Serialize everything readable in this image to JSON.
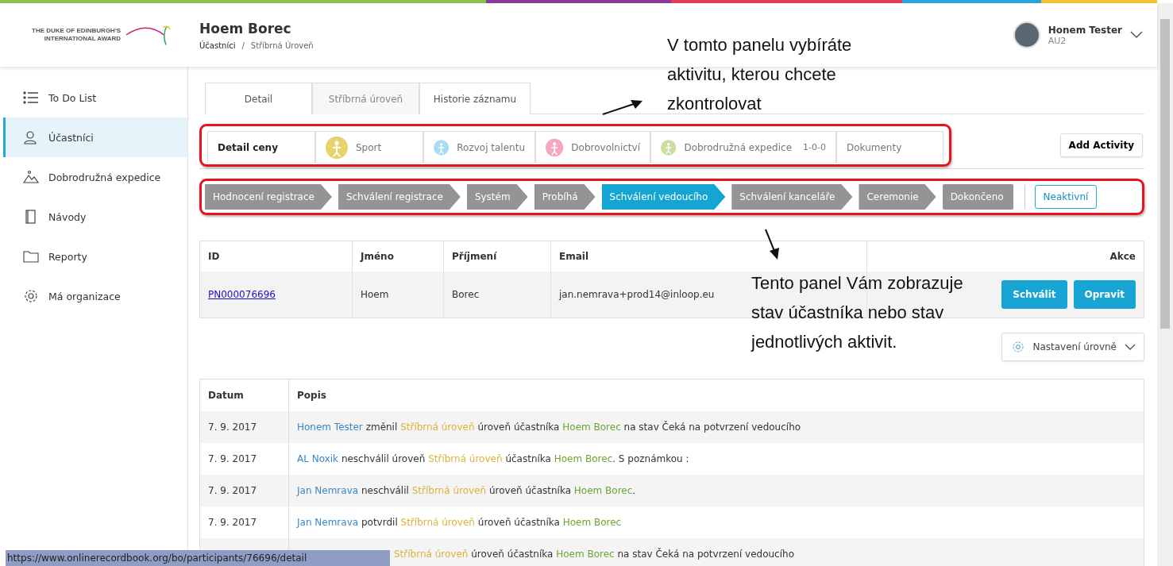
{
  "logo": {
    "lines": [
      "THE DUKE OF EDINBURGH'S",
      "INTERNATIONAL AWARD"
    ]
  },
  "header": {
    "name": "Hoem Borec",
    "breadcrumb": [
      "Účastníci",
      "Stříbrná Úroveň"
    ],
    "separator": "/",
    "user": {
      "name": "Honem Tester",
      "role": "AU2"
    }
  },
  "sidebar": {
    "items": [
      {
        "label": "To Do List",
        "selected": false,
        "kind": "list"
      },
      {
        "label": "Účastníci",
        "selected": true,
        "kind": "people"
      },
      {
        "label": "Dobrodružná expedice",
        "selected": false,
        "kind": "mountain"
      },
      {
        "label": "Návody",
        "selected": false,
        "kind": "book"
      },
      {
        "label": "Reporty",
        "selected": false,
        "kind": "folder"
      },
      {
        "label": "Má organizace",
        "selected": false,
        "kind": "gear"
      }
    ]
  },
  "tabs": [
    {
      "label": "Detail",
      "selected": false
    },
    {
      "label": "Stříbrná úroveň",
      "selected": true
    },
    {
      "label": "Historie záznamu",
      "selected": false
    }
  ],
  "activities": [
    {
      "label": "Detail ceny",
      "selected": true
    },
    {
      "label": "Sport",
      "selected": false,
      "color": "#e6d36b"
    },
    {
      "label": "Rozvoj talentu",
      "selected": false,
      "color": "#a9dcf2"
    },
    {
      "label": "Dobrovolnictví",
      "selected": false,
      "color": "#f4a7be"
    },
    {
      "label": "Dobrodružná expedice",
      "selected": false,
      "color": "#c9dea0",
      "count": "1-0-0"
    },
    {
      "label": "Dokumenty",
      "selected": false
    }
  ],
  "add_activity": "Add Activity",
  "steps": [
    {
      "label": "Hodnocení registrace",
      "selected": false
    },
    {
      "label": "Schválení registrace",
      "selected": false
    },
    {
      "label": "Systém",
      "selected": false
    },
    {
      "label": "Probíhá",
      "selected": false
    },
    {
      "label": "Schválení vedoucího",
      "selected": true
    },
    {
      "label": "Schválení kanceláře",
      "selected": false
    },
    {
      "label": "Ceremonie",
      "selected": false
    },
    {
      "label": "Dokončeno",
      "selected": false
    }
  ],
  "status_button": "Neaktivní",
  "participant_table": {
    "columns": [
      "ID",
      "Jméno",
      "Příjmení",
      "Email",
      "Akce"
    ],
    "rows": [
      {
        "id": "PN000076696",
        "first": "Hoem",
        "last": "Borec",
        "email": "jan.nemrava+prod14@inloop.eu",
        "actions": [
          "Schválit",
          "Opravit"
        ]
      }
    ]
  },
  "level_settings": "Nastavení úrovně",
  "log": {
    "columns": [
      "Datum",
      "Popis"
    ],
    "rows": [
      {
        "date": "7. 9. 2017",
        "parts": [
          {
            "kind": "actor",
            "text": "Honem Tester"
          },
          {
            "kind": "text",
            "text": "změnil"
          },
          {
            "kind": "level",
            "text": "Stříbrná úroveň"
          },
          {
            "kind": "text",
            "text": "úroveň účastníka"
          },
          {
            "kind": "participant",
            "text": "Hoem Borec"
          },
          {
            "kind": "text",
            "text": "na stav Čeká na potvrzení vedoucího"
          }
        ]
      },
      {
        "date": "7. 9. 2017",
        "parts": [
          {
            "kind": "actor",
            "text": "AL Noxik"
          },
          {
            "kind": "text",
            "text": "neschválil úroveň"
          },
          {
            "kind": "level",
            "text": "Stříbrná úroveň"
          },
          {
            "kind": "text",
            "text": "účastníka"
          },
          {
            "kind": "participant",
            "text": "Hoem Borec"
          },
          {
            "kind": "text",
            "text": ". S poznámkou :"
          }
        ]
      },
      {
        "date": "7. 9. 2017",
        "parts": [
          {
            "kind": "actor",
            "text": "Jan Nemrava"
          },
          {
            "kind": "text",
            "text": "neschválil"
          },
          {
            "kind": "level",
            "text": "Stříbrná úroveň"
          },
          {
            "kind": "text",
            "text": "úroveň účastníka"
          },
          {
            "kind": "participant",
            "text": "Hoem Borec"
          },
          {
            "kind": "text",
            "text": "."
          }
        ]
      },
      {
        "date": "7. 9. 2017",
        "parts": [
          {
            "kind": "actor",
            "text": "Jan Nemrava"
          },
          {
            "kind": "text",
            "text": "potvrdil"
          },
          {
            "kind": "level",
            "text": "Stříbrná úroveň"
          },
          {
            "kind": "text",
            "text": "úroveň účastníka"
          },
          {
            "kind": "participant",
            "text": "Hoem Borec"
          }
        ]
      },
      {
        "covered": true,
        "parts": [
          {
            "kind": "level",
            "text": "Stříbrná úroveň"
          },
          {
            "kind": "text",
            "text": "úroveň účastníka"
          },
          {
            "kind": "participant",
            "text": "Hoem Borec"
          },
          {
            "kind": "text",
            "text": "na stav Čeká na potvrzení vedoucího"
          }
        ]
      }
    ]
  },
  "status_bar": "https://www.onlinerecordbook.org/bo/participants/76696/detail",
  "annotations": [
    {
      "text": "V tomto panelu vybíráte aktivitu, kterou chcete zkontrolovat"
    },
    {
      "text": "Tento panel Vám zobrazuje stav účastníka nebo stav jednotlivých aktivit."
    }
  ]
}
